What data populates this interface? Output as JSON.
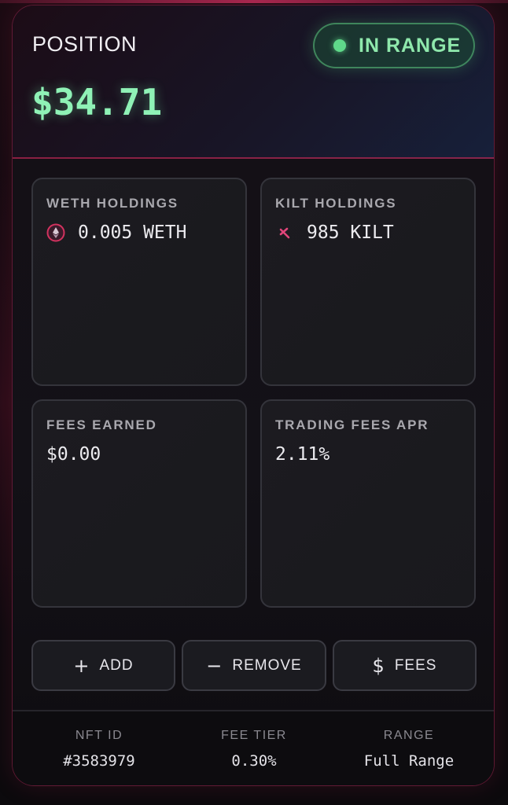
{
  "position": {
    "label": "POSITION",
    "value": "$34.71",
    "status": "IN RANGE",
    "status_color": "#5fd98a"
  },
  "tiles": [
    {
      "label": "WETH HOLDINGS",
      "value": "0.005 WETH",
      "icon": "ethereum-icon"
    },
    {
      "label": "KILT HOLDINGS",
      "value": "985 KILT",
      "icon": "kilt-icon"
    },
    {
      "label": "FEES EARNED",
      "value": "$0.00"
    },
    {
      "label": "TRADING FEES APR",
      "value": "2.11%"
    }
  ],
  "actions": [
    {
      "label": "ADD",
      "icon": "plus-icon"
    },
    {
      "label": "REMOVE",
      "icon": "minus-icon"
    },
    {
      "label": "FEES",
      "icon": "dollar-icon"
    }
  ],
  "footer": [
    {
      "label": "NFT ID",
      "value": "#3583979"
    },
    {
      "label": "FEE TIER",
      "value": "0.30%"
    },
    {
      "label": "RANGE",
      "value": "Full Range"
    }
  ],
  "colors": {
    "accent": "#d2325f",
    "value_green": "#8ff2b6"
  }
}
